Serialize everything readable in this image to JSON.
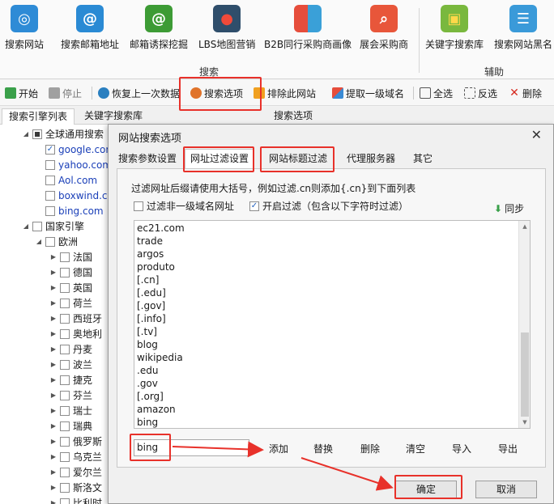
{
  "ribbon": {
    "items": [
      {
        "label": "搜索网站",
        "icon": "globe-search-icon",
        "color": "#2e8bd6"
      },
      {
        "label": "搜索邮箱地址",
        "icon": "email-at-icon",
        "color": "#2a8ad4"
      },
      {
        "label": "邮箱诱探挖掘",
        "icon": "email-mine-icon",
        "color": "#3d9b35"
      },
      {
        "label": "LBS地图营销",
        "icon": "map-pin-icon",
        "color": "#2f4e6b"
      },
      {
        "label": "B2B同行采购商画像",
        "icon": "b2b-profile-icon",
        "color": "#e64d3b"
      },
      {
        "label": "展会采购商",
        "icon": "expo-search-icon",
        "color": "#e8563a"
      },
      {
        "label": "关键字搜索库",
        "icon": "keyword-bag-icon",
        "color": "#79b83e"
      },
      {
        "label": "搜索网站黑名",
        "icon": "blacklist-icon",
        "color": "#3a9ad9"
      }
    ],
    "group_search": "搜索",
    "group_aux": "辅助"
  },
  "toolbar": {
    "start": "开始",
    "stop": "停止",
    "restore": "恢复上一次数据",
    "search_options": "搜索选项",
    "exclude_site": "排除此网站",
    "extract_domain": "提取一级域名",
    "select_all": "全选",
    "invert": "反选",
    "delete": "删除"
  },
  "left_tabs": {
    "engine_list": "搜索引擎列表",
    "keyword_lib": "关键字搜索库",
    "search_opts": "搜索选项"
  },
  "tree": {
    "global_group": "全球通用搜索",
    "engines": [
      "google.com",
      "yahoo.com",
      "Aol.com",
      "boxwind.com",
      "bing.com"
    ],
    "country_engines": "国家引擎",
    "europe": "欧洲",
    "countries": [
      "法国",
      "德国",
      "英国",
      "荷兰",
      "西班牙",
      "奥地利",
      "丹麦",
      "波兰",
      "捷克",
      "芬兰",
      "瑞士",
      "瑞典",
      "俄罗斯",
      "乌克兰",
      "爱尔兰",
      "斯洛文",
      "比利时"
    ]
  },
  "dialog": {
    "title": "网站搜索选项",
    "tabs": [
      "搜索参数设置",
      "网址过滤设置",
      "网站标题过滤",
      "代理服务器",
      "其它"
    ],
    "hint": "过滤网址后缀请使用大括号，例如过滤.cn则添加{.cn}到下面列表",
    "filter_subdomain": "过滤非一级域名网址",
    "enable_filter": "开启过滤（包含以下字符时过滤）",
    "sync": "同步",
    "filter_list": [
      "ec21.com",
      "trade",
      "argos",
      "produto",
      "[.cn]",
      "[.edu]",
      "[.gov]",
      "[.info]",
      "[.tv]",
      "blog",
      "wikipedia",
      ".edu",
      ".gov",
      "[.org]",
      "amazon",
      "bing"
    ],
    "input_value": "bing",
    "actions": {
      "add": "添加",
      "replace": "替换",
      "delete": "删除",
      "clear": "清空",
      "import": "导入",
      "export": "导出"
    },
    "ok": "确定",
    "cancel": "取消"
  },
  "colors": {
    "highlight": "#e8312a",
    "link": "#1a3fb8"
  }
}
